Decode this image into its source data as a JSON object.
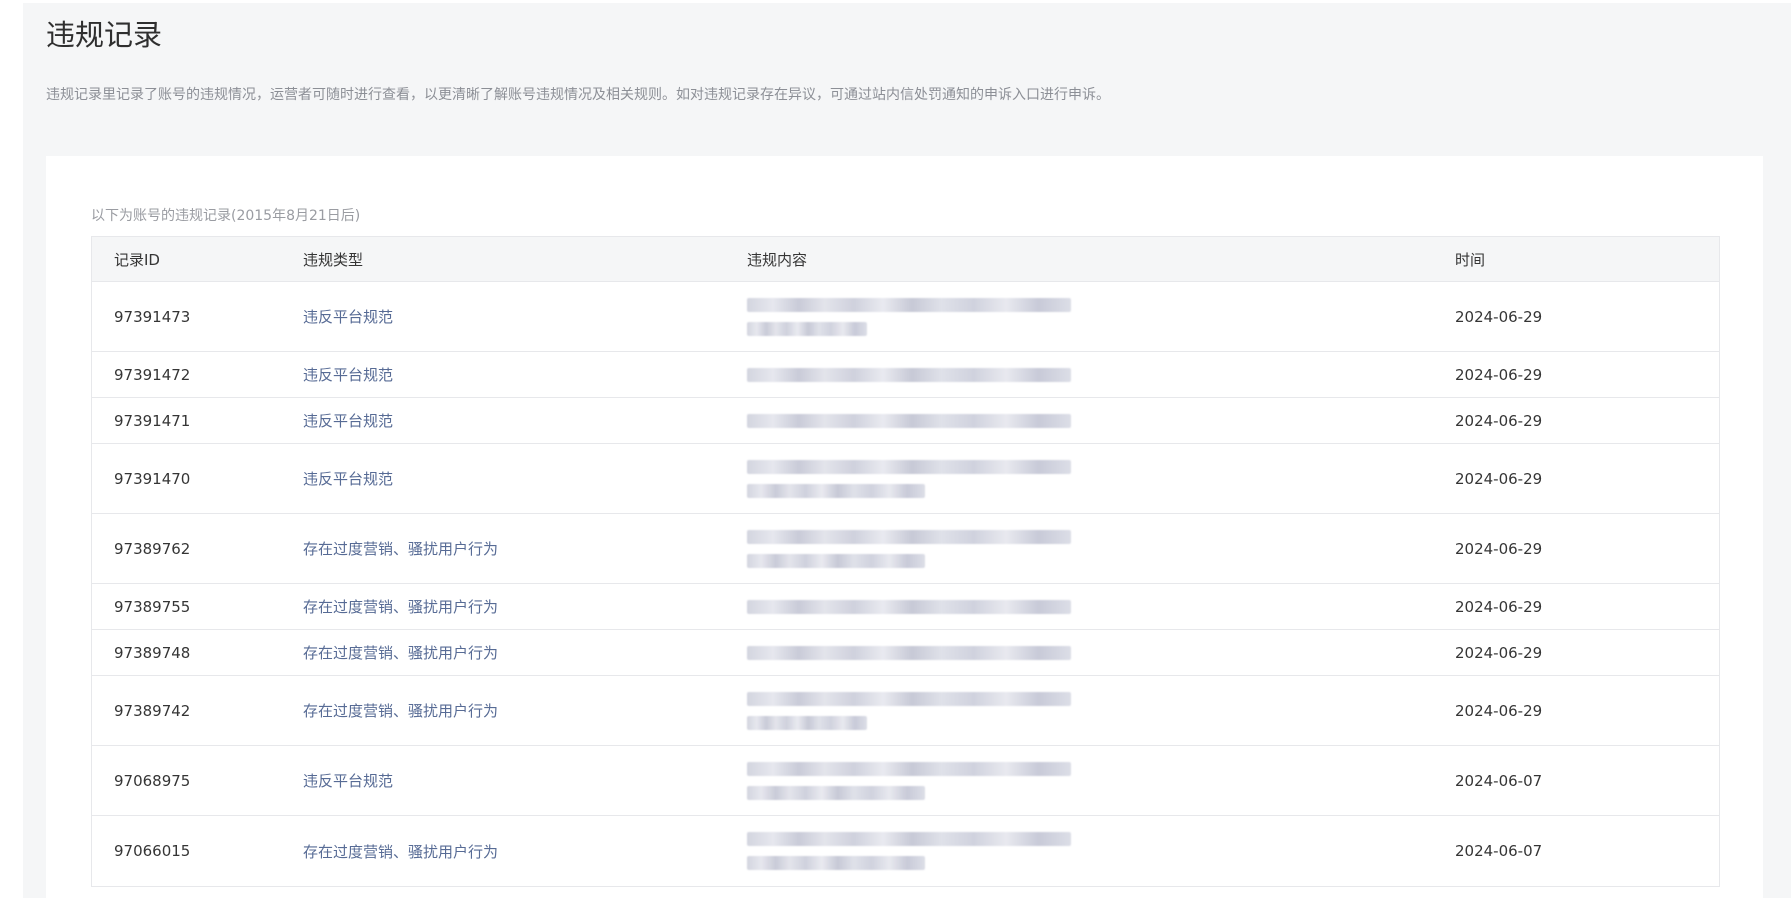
{
  "page": {
    "title": "违规记录",
    "description": "违规记录里记录了账号的违规情况，运营者可随时进行查看，以更清晰了解账号违规情况及相关规则。如对违规记录存在异议，可通过站内信处罚通知的申诉入口进行申诉。"
  },
  "records": {
    "caption": "以下为账号的违规记录(2015年8月21日后)",
    "columns": {
      "id": "记录ID",
      "type": "违规类型",
      "content": "违规内容",
      "time": "时间"
    },
    "rows": [
      {
        "id": "97391473",
        "type": "违反平台规范",
        "time": "2024-06-29"
      },
      {
        "id": "97391472",
        "type": "违反平台规范",
        "time": "2024-06-29"
      },
      {
        "id": "97391471",
        "type": "违反平台规范",
        "time": "2024-06-29"
      },
      {
        "id": "97391470",
        "type": "违反平台规范",
        "time": "2024-06-29"
      },
      {
        "id": "97389762",
        "type": "存在过度营销、骚扰用户行为",
        "time": "2024-06-29"
      },
      {
        "id": "97389755",
        "type": "存在过度营销、骚扰用户行为",
        "time": "2024-06-29"
      },
      {
        "id": "97389748",
        "type": "存在过度营销、骚扰用户行为",
        "time": "2024-06-29"
      },
      {
        "id": "97389742",
        "type": "存在过度营销、骚扰用户行为",
        "time": "2024-06-29"
      },
      {
        "id": "97068975",
        "type": "违反平台规范",
        "time": "2024-06-07"
      },
      {
        "id": "97066015",
        "type": "存在过度营销、骚扰用户行为",
        "time": "2024-06-07"
      }
    ]
  },
  "colors": {
    "page_bg": "#f5f6f7",
    "card_bg": "#ffffff",
    "link": "#576b95",
    "muted": "#8c8f96",
    "border": "#e7e8eb"
  }
}
